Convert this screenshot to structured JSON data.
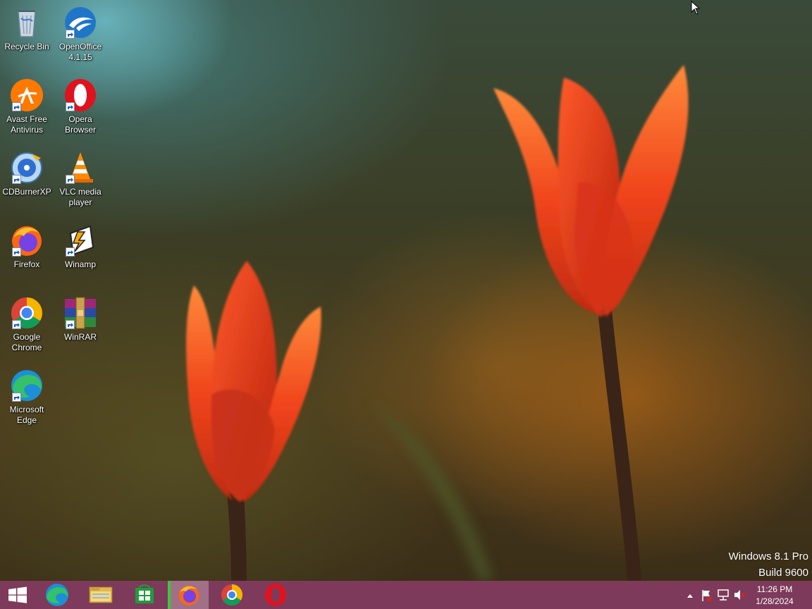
{
  "desktop_icons": [
    {
      "label": "Recycle Bin",
      "icon": "recycle-bin-icon"
    },
    {
      "label": "OpenOffice 4.1.15",
      "icon": "openoffice-icon"
    },
    {
      "label": "Avast Free Antivirus",
      "icon": "avast-icon"
    },
    {
      "label": "Opera Browser",
      "icon": "opera-icon"
    },
    {
      "label": "CDBurnerXP",
      "icon": "cdburnerxp-icon"
    },
    {
      "label": "VLC media player",
      "icon": "vlc-icon"
    },
    {
      "label": "Firefox",
      "icon": "firefox-icon"
    },
    {
      "label": "Winamp",
      "icon": "winamp-icon"
    },
    {
      "label": "Google Chrome",
      "icon": "chrome-icon"
    },
    {
      "label": "WinRAR",
      "icon": "winrar-icon"
    },
    {
      "label": "Microsoft Edge",
      "icon": "edge-icon"
    }
  ],
  "watermark": {
    "line1": "Windows 8.1 Pro",
    "line2": "Build 9600"
  },
  "taskbar": {
    "color": "#7d3a5a",
    "pinned": [
      "start-icon",
      "edge-icon",
      "file-explorer-icon",
      "store-icon",
      "firefox-icon",
      "chrome-icon",
      "opera-icon"
    ],
    "active": "firefox-icon"
  },
  "tray": {
    "time": "11:26 PM",
    "date": "1/28/2024",
    "icons": [
      "show-hidden-icons",
      "action-center-flag-icon",
      "network-icon",
      "volume-muted-icon"
    ]
  }
}
